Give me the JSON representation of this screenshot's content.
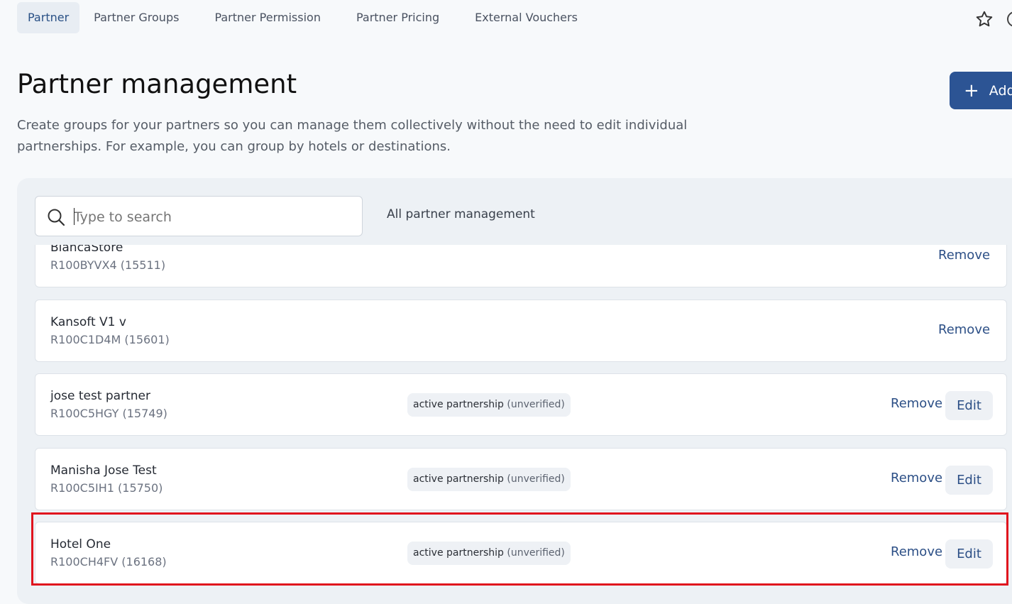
{
  "tabs": [
    {
      "label": "Partner",
      "active": true
    },
    {
      "label": "Partner Groups"
    },
    {
      "label": "Partner Permission"
    },
    {
      "label": "Partner Pricing"
    },
    {
      "label": "External Vouchers"
    }
  ],
  "page": {
    "title": "Partner management",
    "description": "Create groups for your partners so you can manage them collectively without the need to edit individual partnerships. For example, you can group by hotels or destinations.",
    "add_label": "Add"
  },
  "search": {
    "placeholder": "Type to search",
    "value": ""
  },
  "filter_label": "All partner management",
  "rows": [
    {
      "name": "BlancaStore",
      "code": "R100BYVX4 (15511)",
      "remove": "Remove"
    },
    {
      "name": "Kansoft V1 v",
      "code": "R100C1D4M (15601)",
      "remove": "Remove"
    },
    {
      "name": "jose test partner",
      "code": "R100C5HGY (15749)",
      "badge": "active partnership",
      "badge_sub": "(unverified)",
      "remove": "Remove",
      "edit": "Edit"
    },
    {
      "name": "Manisha Jose Test",
      "code": "R100C5IH1 (15750)",
      "badge": "active partnership",
      "badge_sub": "(unverified)",
      "remove": "Remove",
      "edit": "Edit"
    },
    {
      "name": "Hotel One",
      "code": "R100CH4FV (16168)",
      "badge": "active partnership",
      "badge_sub": "(unverified)",
      "remove": "Remove",
      "edit": "Edit"
    }
  ],
  "colors": {
    "accent": "#2c5494",
    "link": "#2c4f86",
    "highlight": "#e0141e"
  }
}
